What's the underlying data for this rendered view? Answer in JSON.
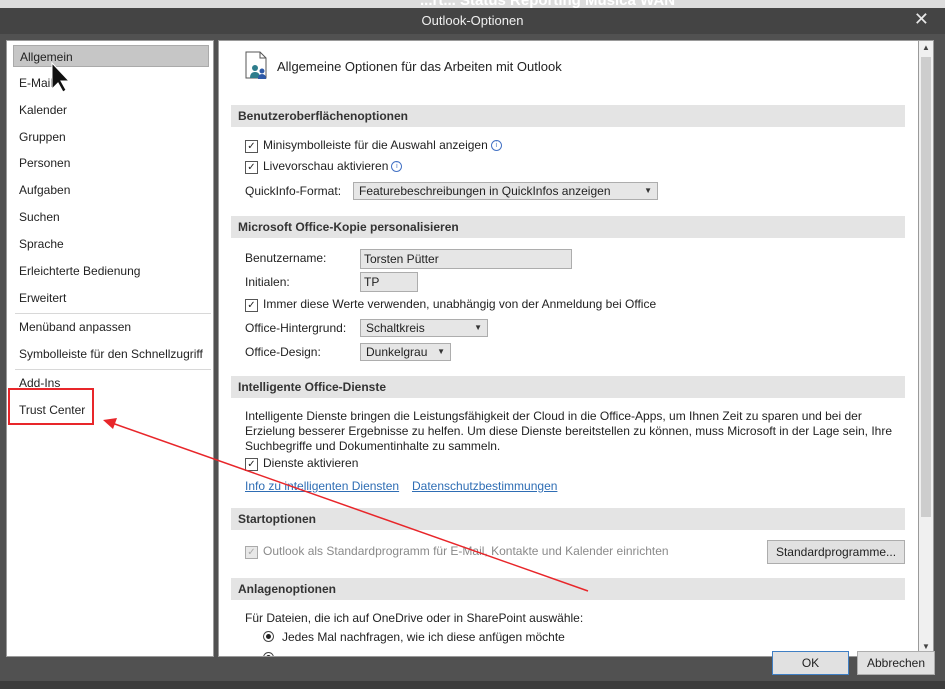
{
  "background": {
    "title": "...rt... Status Reporting Musica WAN"
  },
  "window": {
    "title": "Outlook-Optionen",
    "close_glyph": "✕"
  },
  "sidebar": {
    "items": [
      {
        "label": "Allgemein"
      },
      {
        "label": "E-Mail"
      },
      {
        "label": "Kalender"
      },
      {
        "label": "Gruppen"
      },
      {
        "label": "Personen"
      },
      {
        "label": "Aufgaben"
      },
      {
        "label": "Suchen"
      },
      {
        "label": "Sprache"
      },
      {
        "label": "Erleichterte Bedienung"
      },
      {
        "label": "Erweitert"
      },
      {
        "label": "Menüband anpassen"
      },
      {
        "label": "Symbolleiste für den Schnellzugriff"
      },
      {
        "label": "Add-Ins"
      },
      {
        "label": "Trust Center"
      }
    ],
    "selected": "Allgemein"
  },
  "main": {
    "header": "Allgemeine Optionen für das Arbeiten mit Outlook",
    "ui_options": {
      "heading": "Benutzeroberflächenoptionen",
      "mini_toolbar": "Minisymbolleiste für die Auswahl anzeigen",
      "live_preview": "Livevorschau aktivieren",
      "tooltip_label": "QuickInfo-Format:",
      "tooltip_value": "Featurebeschreibungen in QuickInfos anzeigen"
    },
    "personalize": {
      "heading": "Microsoft Office-Kopie personalisieren",
      "username_label": "Benutzername:",
      "username_value": "Torsten Pütter",
      "initials_label": "Initialen:",
      "initials_value": "TP",
      "always_use": "Immer diese Werte verwenden, unabhängig von der Anmeldung bei Office",
      "background_label": "Office-Hintergrund:",
      "background_value": "Schaltkreis",
      "design_label": "Office-Design:",
      "design_value": "Dunkelgrau"
    },
    "intelligent": {
      "heading": "Intelligente Office-Dienste",
      "description_1": "Intelligente Dienste bringen die Leistungsfähigkeit der Cloud in die Office-Apps, um Ihnen Zeit zu sparen und bei der",
      "description_2": "Erzielung besserer Ergebnisse zu helfen. Um diese Dienste bereitstellen zu können, muss Microsoft in der Lage sein, Ihre",
      "description_3": "Suchbegriffe und Dokumentinhalte zu sammeln.",
      "enable": "Dienste aktivieren",
      "link_info": "Info zu intelligenten Diensten",
      "link_privacy": "Datenschutzbestimmungen"
    },
    "startup": {
      "heading": "Startoptionen",
      "default_program": "Outlook als Standardprogramm für E-Mail, Kontakte und Kalender einrichten",
      "default_programs_button": "Standardprogramme..."
    },
    "attachments": {
      "heading": "Anlagenoptionen",
      "intro": "Für Dateien, die ich auf OneDrive oder in SharePoint auswähle:",
      "ask_each_time": "Jedes Mal nachfragen, wie ich diese anfügen möchte"
    }
  },
  "footer": {
    "ok_label": "OK",
    "cancel_label": "Abbrechen"
  },
  "icons": {
    "check": "✓",
    "dropdown": "▼",
    "scroll_up": "▲",
    "scroll_down": "▼",
    "info": "i"
  },
  "colors": {
    "annotation": "#e8262a",
    "link": "#2e6db4",
    "title_bar": "#444444"
  }
}
